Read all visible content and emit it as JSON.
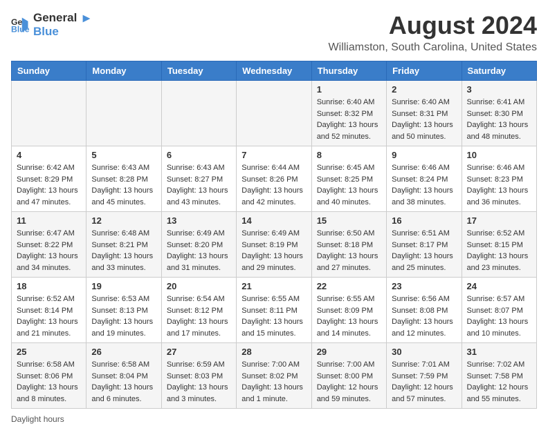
{
  "logo": {
    "line1": "General",
    "line2": "Blue"
  },
  "title": "August 2024",
  "subtitle": "Williamston, South Carolina, United States",
  "weekdays": [
    "Sunday",
    "Monday",
    "Tuesday",
    "Wednesday",
    "Thursday",
    "Friday",
    "Saturday"
  ],
  "weeks": [
    [
      {
        "day": "",
        "info": ""
      },
      {
        "day": "",
        "info": ""
      },
      {
        "day": "",
        "info": ""
      },
      {
        "day": "",
        "info": ""
      },
      {
        "day": "1",
        "info": "Sunrise: 6:40 AM\nSunset: 8:32 PM\nDaylight: 13 hours and 52 minutes."
      },
      {
        "day": "2",
        "info": "Sunrise: 6:40 AM\nSunset: 8:31 PM\nDaylight: 13 hours and 50 minutes."
      },
      {
        "day": "3",
        "info": "Sunrise: 6:41 AM\nSunset: 8:30 PM\nDaylight: 13 hours and 48 minutes."
      }
    ],
    [
      {
        "day": "4",
        "info": "Sunrise: 6:42 AM\nSunset: 8:29 PM\nDaylight: 13 hours and 47 minutes."
      },
      {
        "day": "5",
        "info": "Sunrise: 6:43 AM\nSunset: 8:28 PM\nDaylight: 13 hours and 45 minutes."
      },
      {
        "day": "6",
        "info": "Sunrise: 6:43 AM\nSunset: 8:27 PM\nDaylight: 13 hours and 43 minutes."
      },
      {
        "day": "7",
        "info": "Sunrise: 6:44 AM\nSunset: 8:26 PM\nDaylight: 13 hours and 42 minutes."
      },
      {
        "day": "8",
        "info": "Sunrise: 6:45 AM\nSunset: 8:25 PM\nDaylight: 13 hours and 40 minutes."
      },
      {
        "day": "9",
        "info": "Sunrise: 6:46 AM\nSunset: 8:24 PM\nDaylight: 13 hours and 38 minutes."
      },
      {
        "day": "10",
        "info": "Sunrise: 6:46 AM\nSunset: 8:23 PM\nDaylight: 13 hours and 36 minutes."
      }
    ],
    [
      {
        "day": "11",
        "info": "Sunrise: 6:47 AM\nSunset: 8:22 PM\nDaylight: 13 hours and 34 minutes."
      },
      {
        "day": "12",
        "info": "Sunrise: 6:48 AM\nSunset: 8:21 PM\nDaylight: 13 hours and 33 minutes."
      },
      {
        "day": "13",
        "info": "Sunrise: 6:49 AM\nSunset: 8:20 PM\nDaylight: 13 hours and 31 minutes."
      },
      {
        "day": "14",
        "info": "Sunrise: 6:49 AM\nSunset: 8:19 PM\nDaylight: 13 hours and 29 minutes."
      },
      {
        "day": "15",
        "info": "Sunrise: 6:50 AM\nSunset: 8:18 PM\nDaylight: 13 hours and 27 minutes."
      },
      {
        "day": "16",
        "info": "Sunrise: 6:51 AM\nSunset: 8:17 PM\nDaylight: 13 hours and 25 minutes."
      },
      {
        "day": "17",
        "info": "Sunrise: 6:52 AM\nSunset: 8:15 PM\nDaylight: 13 hours and 23 minutes."
      }
    ],
    [
      {
        "day": "18",
        "info": "Sunrise: 6:52 AM\nSunset: 8:14 PM\nDaylight: 13 hours and 21 minutes."
      },
      {
        "day": "19",
        "info": "Sunrise: 6:53 AM\nSunset: 8:13 PM\nDaylight: 13 hours and 19 minutes."
      },
      {
        "day": "20",
        "info": "Sunrise: 6:54 AM\nSunset: 8:12 PM\nDaylight: 13 hours and 17 minutes."
      },
      {
        "day": "21",
        "info": "Sunrise: 6:55 AM\nSunset: 8:11 PM\nDaylight: 13 hours and 15 minutes."
      },
      {
        "day": "22",
        "info": "Sunrise: 6:55 AM\nSunset: 8:09 PM\nDaylight: 13 hours and 14 minutes."
      },
      {
        "day": "23",
        "info": "Sunrise: 6:56 AM\nSunset: 8:08 PM\nDaylight: 13 hours and 12 minutes."
      },
      {
        "day": "24",
        "info": "Sunrise: 6:57 AM\nSunset: 8:07 PM\nDaylight: 13 hours and 10 minutes."
      }
    ],
    [
      {
        "day": "25",
        "info": "Sunrise: 6:58 AM\nSunset: 8:06 PM\nDaylight: 13 hours and 8 minutes."
      },
      {
        "day": "26",
        "info": "Sunrise: 6:58 AM\nSunset: 8:04 PM\nDaylight: 13 hours and 6 minutes."
      },
      {
        "day": "27",
        "info": "Sunrise: 6:59 AM\nSunset: 8:03 PM\nDaylight: 13 hours and 3 minutes."
      },
      {
        "day": "28",
        "info": "Sunrise: 7:00 AM\nSunset: 8:02 PM\nDaylight: 13 hours and 1 minute."
      },
      {
        "day": "29",
        "info": "Sunrise: 7:00 AM\nSunset: 8:00 PM\nDaylight: 12 hours and 59 minutes."
      },
      {
        "day": "30",
        "info": "Sunrise: 7:01 AM\nSunset: 7:59 PM\nDaylight: 12 hours and 57 minutes."
      },
      {
        "day": "31",
        "info": "Sunrise: 7:02 AM\nSunset: 7:58 PM\nDaylight: 12 hours and 55 minutes."
      }
    ]
  ],
  "footer": "Daylight hours"
}
